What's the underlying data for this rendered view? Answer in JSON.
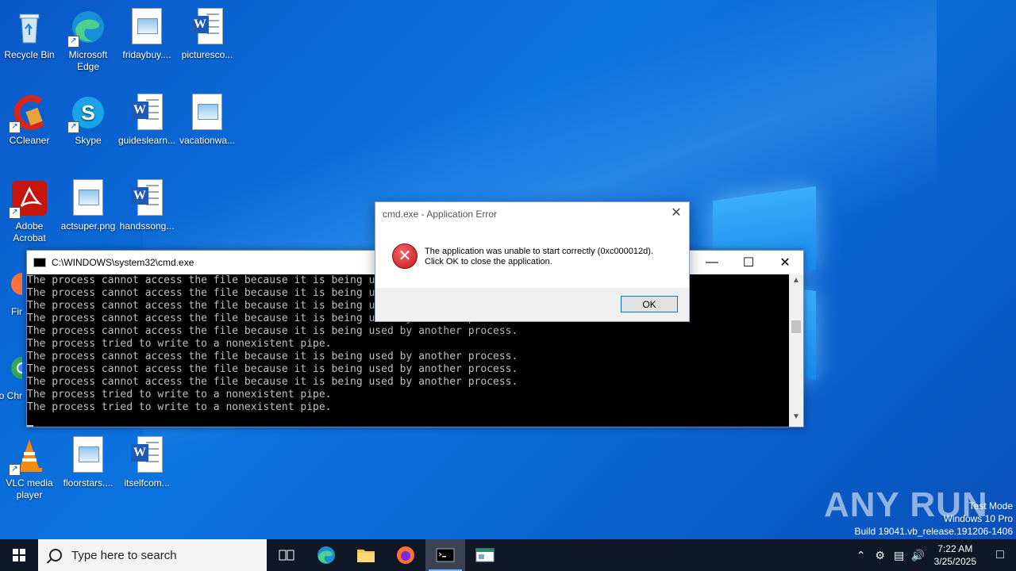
{
  "desktop": {
    "icons": [
      {
        "label": "Recycle Bin"
      },
      {
        "label": "Microsoft Edge"
      },
      {
        "label": "fridaybuy...."
      },
      {
        "label": "picturesco..."
      },
      {
        "label": "CCleaner"
      },
      {
        "label": "Skype"
      },
      {
        "label": "guideslearn..."
      },
      {
        "label": "vacationwa..."
      },
      {
        "label": "Adobe Acrobat"
      },
      {
        "label": "actsuper.png"
      },
      {
        "label": "handssong..."
      },
      {
        "label": "Fir"
      },
      {
        "label": "Go Chr"
      },
      {
        "label": "VLC media player"
      },
      {
        "label": "floorstars...."
      },
      {
        "label": "itselfcom..."
      }
    ]
  },
  "cmd_window": {
    "title": "C:\\WINDOWS\\system32\\cmd.exe",
    "lines": [
      "The process cannot access the file because it is being used by another process.",
      "The process cannot access the file because it is being used by another process.",
      "The process cannot access the file because it is being used by another process.",
      "The process cannot access the file because it is being used by another process.",
      "The process cannot access the file because it is being used by another process.",
      "The process tried to write to a nonexistent pipe.",
      "The process cannot access the file because it is being used by another process.",
      "The process cannot access the file because it is being used by another process.",
      "The process cannot access the file because it is being used by another process.",
      "The process tried to write to a nonexistent pipe.",
      "The process tried to write to a nonexistent pipe."
    ]
  },
  "error_dialog": {
    "title": "cmd.exe - Application Error",
    "message_line1": "The application was unable to start correctly (0xc000012d).",
    "message_line2": "Click OK to close the application.",
    "ok_label": "OK"
  },
  "watermark": {
    "brand": "ANY RUN",
    "line1": "Test Mode",
    "line2": "Windows 10 Pro",
    "line3": "Build 19041.vb_release.191206-1406"
  },
  "taskbar": {
    "search_placeholder": "Type here to search",
    "time": "7:22 AM",
    "date": "3/25/2025"
  }
}
